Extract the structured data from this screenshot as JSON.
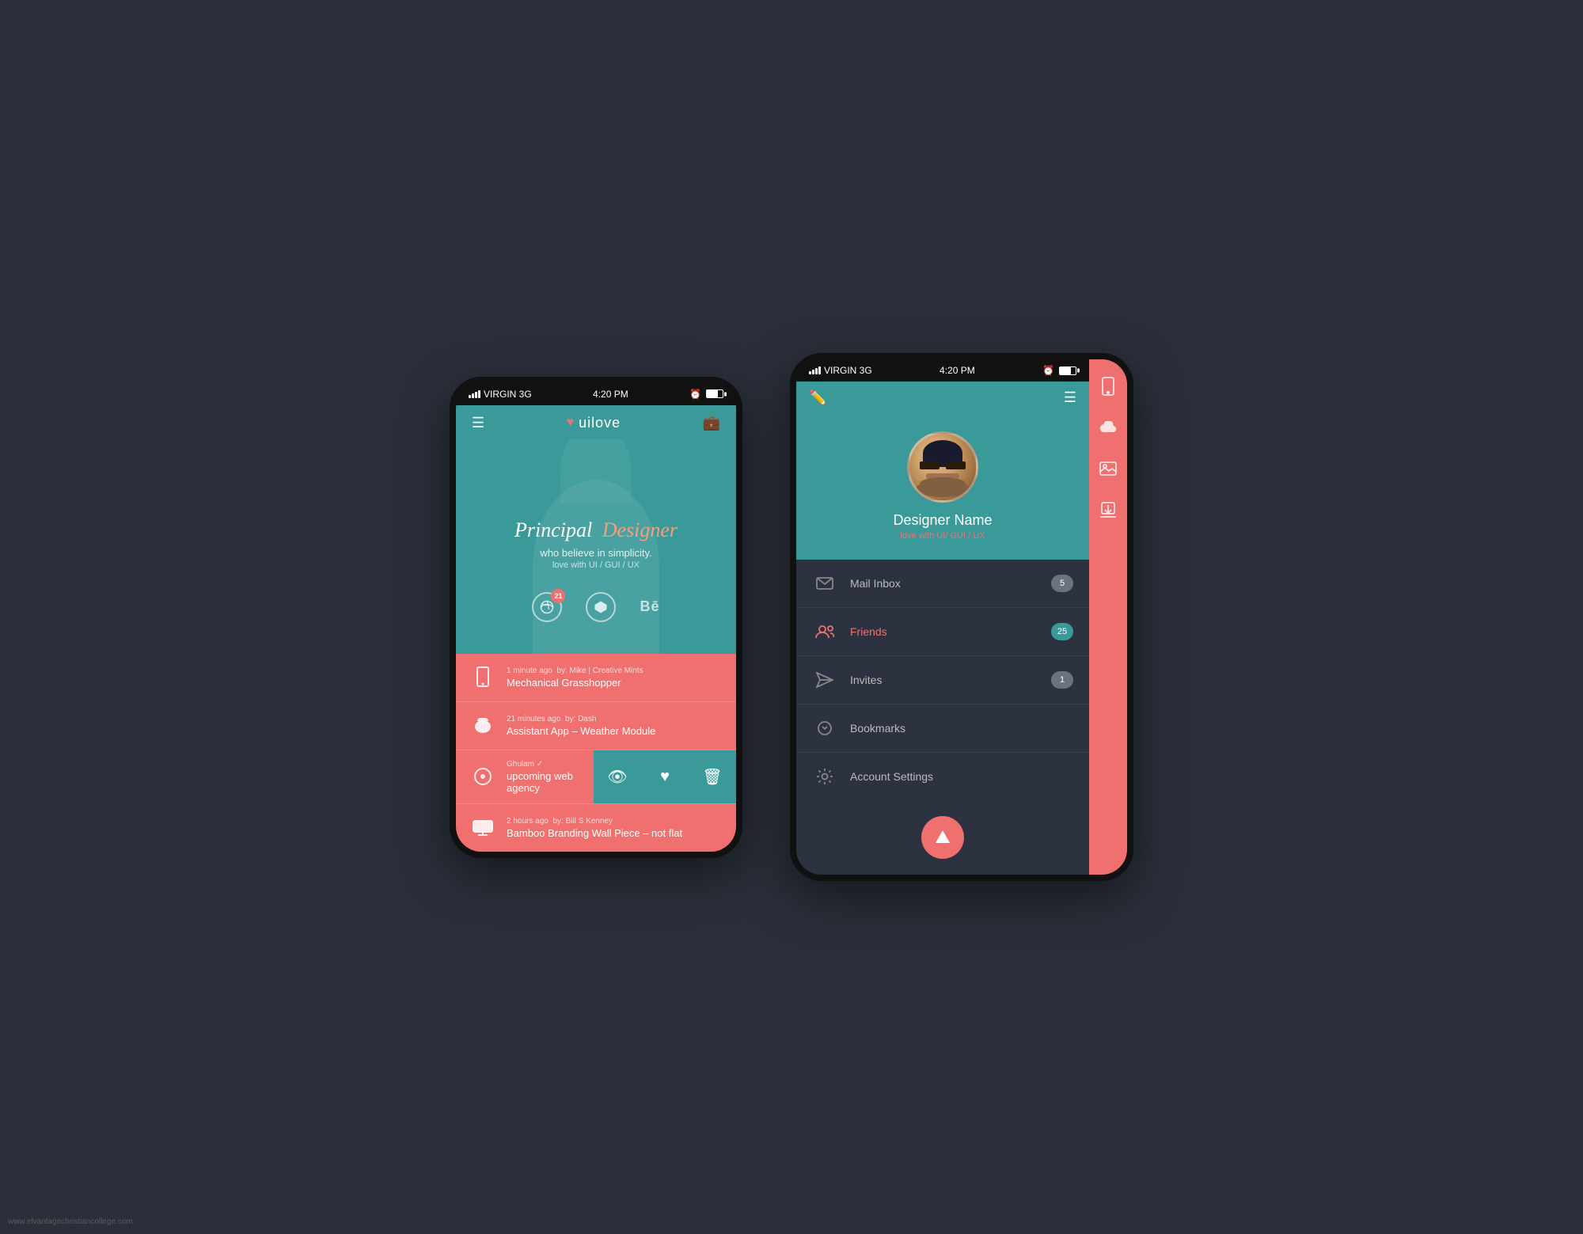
{
  "app": {
    "name": "uilove",
    "tagline": "Principal",
    "tagline_highlight": "Designer",
    "subtitle1": "who believe in simplicity.",
    "subtitle2": "love with UI / GUI / UX"
  },
  "status_bar": {
    "carrier": "VIRGIN  3G",
    "time": "4:20 PM"
  },
  "social": {
    "dribbble_badge": "21"
  },
  "feed": [
    {
      "time_ago": "1 minute ago",
      "by": "by: Mike | Creative Mints",
      "title": "Mechanical Grasshopper",
      "icon": "mobile"
    },
    {
      "time_ago": "21 minutes ago",
      "by": "by: Dash",
      "title": "Assistant App – Weather Module",
      "icon": "cloud"
    },
    {
      "time_ago": "",
      "by": "Ghulam ✓",
      "title": "upcoming web agency",
      "icon": "globe"
    },
    {
      "time_ago": "2 hours ago",
      "by": "by: Bill S Kenney",
      "title": "Bamboo Branding  Wall Piece – not flat",
      "icon": "desktop"
    }
  ],
  "profile": {
    "name": "Designer Name",
    "subtitle": "love with UI/ GUI / UX"
  },
  "menu": [
    {
      "icon": "mail",
      "label": "Mail Inbox",
      "badge": "5",
      "badge_type": "gray"
    },
    {
      "icon": "friends",
      "label": "Friends",
      "badge": "25",
      "badge_type": "teal"
    },
    {
      "icon": "send",
      "label": "Invites",
      "badge": "1",
      "badge_type": "gray"
    },
    {
      "icon": "bookmark",
      "label": "Bookmarks",
      "badge": "",
      "badge_type": ""
    },
    {
      "icon": "settings",
      "label": "Account Settings",
      "badge": "",
      "badge_type": ""
    }
  ],
  "watermark": "www.elvantagechristiancollege.com"
}
